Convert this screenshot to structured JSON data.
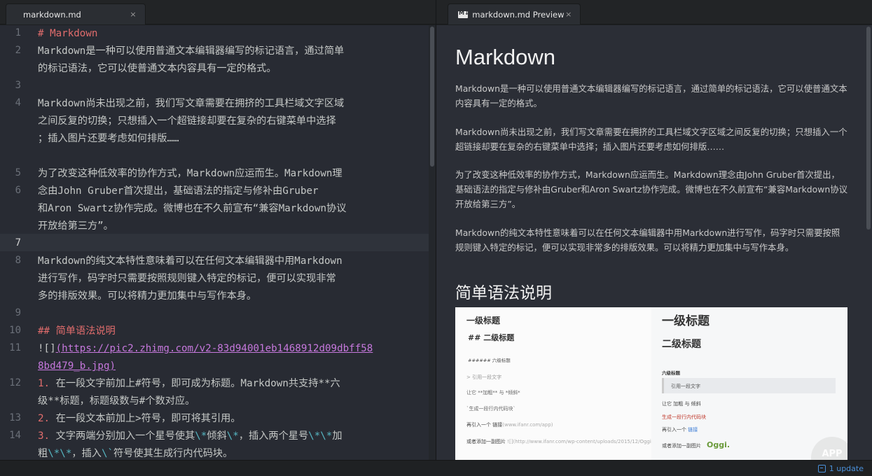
{
  "left_tab": {
    "title": "markdown.md",
    "close": "×"
  },
  "right_tab": {
    "title": "markdown.md Preview",
    "close": "×"
  },
  "editor": {
    "current_line": 7,
    "line_numbers": [
      "1",
      "2",
      "3",
      "4",
      "5",
      "6",
      "7",
      "8",
      "9",
      "10",
      "11",
      "12",
      "13",
      "14"
    ],
    "lines": [
      "# Markdown",
      "Markdown是一种可以使用普通文本编辑器编写的标记语言，通过简单",
      "的标记语法，它可以使普通文本内容具有一定的格式。",
      "Markdown尚未出现之前，我们写文章需要在拥挤的工具栏域文字区域",
      "之间反复的切换；只想插入一个超链接却要在复杂的右键菜单中选择",
      "；插入图片还要考虑如何排版……",
      "为了改变这种低效率的协作方式，Markdown应运而生。Markdown理",
      "念由John Gruber首次提出，基础语法的指定与修补由Gruber",
      "和Aron Swartz协作完成。微博也在不久前宣布“兼容Markdown协议",
      "开放给第三方”。",
      "Markdown的纯文本特性意味着可以在任何文本编辑器中用Markdown",
      "进行写作，码字时只需要按照规则键入特定的标记，便可以实现非常",
      "多的排版效果。可以将精力更加集中与写作本身。",
      "## 简单语法说明",
      "![]",
      "(https://pic2.zhimg.com/v2-83d94001eb1468912d09dbff58",
      "8bd479_b.jpg)",
      "1.",
      " 在一段文字前加上#符号，即可成为标题。Markdown共支持**六",
      "级**标题，标题级数与#个数对应。",
      "2.",
      " 在一段文本前加上>符号，即可将其引用。",
      "3.",
      " 文字两端分别加入一个星号使其",
      "\\*",
      "倾斜",
      "\\*",
      "，插入两个星号",
      "\\*\\*",
      "加",
      "粗",
      "\\*\\*",
      "，插入",
      "\\`",
      "符号使其生成行内代码块。"
    ]
  },
  "preview": {
    "h1": "Markdown",
    "p1": "Markdown是一种可以使用普通文本编辑器编写的标记语言，通过简单的标记语法，它可以使普通文本内容具有一定的格式。",
    "p2": "Markdown尚未出现之前，我们写文章需要在拥挤的工具栏域文字区域之间反复的切换；只想插入一个超链接却要在复杂的右键菜单中选择；插入图片还要考虑如何排版……",
    "p3": "为了改变这种低效率的协作方式，Markdown应运而生。Markdown理念由John Gruber首次提出，基础语法的指定与修补由Gruber和Aron Swartz协作完成。微博也在不久前宣布“兼容Markdown协议开放给第三方”。",
    "p4": "Markdown的纯文本特性意味着可以在任何文本编辑器中用Markdown进行写作，码字时只需要按照规则键入特定的标记，便可以实现非常多的排版效果。可以将精力更加集中与写作本身。",
    "h2": "简单语法说明",
    "image": {
      "left": {
        "h1": "一级标题",
        "h2": "## 二级标题",
        "h6": "###### 六级标题",
        "quote": "> 引用一段文字",
        "emph": "让它 **加粗** 与 *倾斜*",
        "code": "`生成一段行内代码块`",
        "link_prefix": "再引入一个 链接",
        "link_url": "(www.ifanr.com/app)",
        "img_prefix": "或者添加一副图片",
        "img_url": "![](http://www.ifanr.com/wp-content/uploads/2015/12/Oggi-1-2.png)"
      },
      "right": {
        "h1": "一级标题",
        "h2": "二级标题",
        "h6": "六级标题",
        "quote": "引用一段文字",
        "emph": "让它 加粗 与 倾斜",
        "code": "生成一段行内代码块",
        "link_prefix": "再引入一个",
        "link_text": "链接",
        "img_prefix": "或者添加一副图片",
        "logo": "Oggi.",
        "watermark": "APP"
      }
    }
  },
  "statusbar": {
    "update_label": "1 update",
    "update_icon": "package-icon"
  }
}
